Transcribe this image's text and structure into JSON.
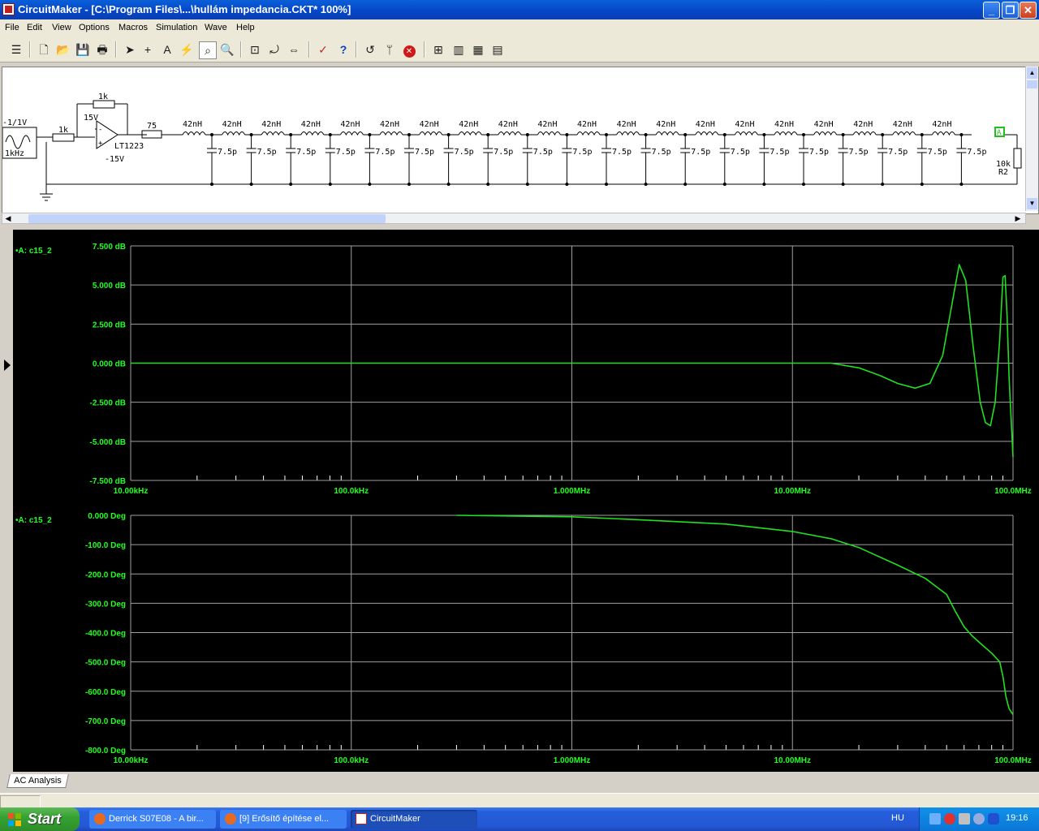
{
  "window": {
    "title": "CircuitMaker - [C:\\Program Files\\...\\hullám impedancia.CKT* 100%]",
    "buttons": {
      "minimize": "_",
      "maximize": "❐",
      "close": "✕"
    }
  },
  "menu": [
    "File",
    "Edit",
    "View",
    "Options",
    "Macros",
    "Simulation",
    "Wave",
    "Help"
  ],
  "toolbar": {
    "icons": [
      "tape-icon",
      "new-file-icon",
      "open-folder-icon",
      "save-icon",
      "print-icon",
      "arrow-tool-icon",
      "wire-tool-icon",
      "text-tool-icon",
      "probe-tool-icon",
      "zoom-hand-icon",
      "magnifier-icon",
      "zoom-fit-icon",
      "rotate-icon",
      "mirror-icon",
      "checklist-icon",
      "help-icon",
      "reset-icon",
      "stop-sim-icon",
      "step-icon",
      "run-icon",
      "waveform-icon",
      "analyses-icon"
    ]
  },
  "schematic": {
    "source_label": "-1/1V",
    "source_freq": "1kHz",
    "resistor_in": "1k",
    "resistor_fb": "1k",
    "supply_pos": "15V",
    "supply_neg": "-15V",
    "opamp": "LT1223",
    "resistor_series": "75",
    "inductor": "42nH",
    "capacitor": "7.5p",
    "load_value": "10k",
    "load_name": "R2",
    "probe_label": "A",
    "sections": 20
  },
  "plots": [
    {
      "name": "magnitude",
      "trace_label": "•A: c15_2",
      "y_ticks": [
        "7.500 dB",
        "5.000 dB",
        "2.500 dB",
        "0.000 dB",
        "-2.500 dB",
        "-5.000 dB",
        "-7.500 dB"
      ],
      "x_ticks": [
        "10.00kHz",
        "100.0kHz",
        "1.000MHz",
        "10.00MHz",
        "100.0MHz"
      ]
    },
    {
      "name": "phase",
      "trace_label": "•A: c15_2",
      "y_ticks": [
        "0.000 Deg",
        "-100.0 Deg",
        "-200.0 Deg",
        "-300.0 Deg",
        "-400.0 Deg",
        "-500.0 Deg",
        "-600.0 Deg",
        "-700.0 Deg",
        "-800.0 Deg"
      ],
      "x_ticks": [
        "10.00kHz",
        "100.0kHz",
        "1.000MHz",
        "10.00MHz",
        "100.0MHz"
      ]
    }
  ],
  "chart_data": [
    {
      "type": "line",
      "title": "",
      "xlabel": "",
      "ylabel": "",
      "x_scale": "log",
      "xlim": [
        10000,
        100000000
      ],
      "ylim": [
        -7.5,
        7.5
      ],
      "grid": true,
      "series": [
        {
          "name": "A: c15_2",
          "color": "#20e020",
          "x": [
            10000,
            1000000,
            5000000,
            10000000,
            15000000,
            20000000,
            25000000,
            30000000,
            36000000,
            42000000,
            48000000,
            54000000,
            57000000,
            61000000,
            66000000,
            71000000,
            75000000,
            79000000,
            83000000,
            87000000,
            90000000,
            92000000,
            94000000,
            96000000,
            98000000,
            100000000
          ],
          "y": [
            0,
            0,
            0,
            0,
            0,
            -0.3,
            -0.8,
            -1.3,
            -1.6,
            -1.3,
            0.5,
            4.5,
            6.3,
            5.3,
            1.0,
            -2.5,
            -3.8,
            -4.0,
            -2.5,
            1.5,
            5.5,
            5.6,
            3.0,
            -1.0,
            -3.5,
            -6.0
          ]
        }
      ]
    },
    {
      "type": "line",
      "title": "",
      "xlabel": "",
      "ylabel": "",
      "x_scale": "log",
      "xlim": [
        10000,
        100000000
      ],
      "ylim": [
        -800,
        0
      ],
      "grid": true,
      "series": [
        {
          "name": "A: c15_2",
          "color": "#20e020",
          "x": [
            300000,
            1000000,
            2000000,
            5000000,
            10000000,
            15000000,
            20000000,
            30000000,
            40000000,
            50000000,
            55000000,
            60000000,
            65000000,
            72000000,
            80000000,
            87000000,
            90000000,
            93000000,
            96000000,
            100000000
          ],
          "y": [
            0,
            -5,
            -15,
            -30,
            -55,
            -80,
            -110,
            -170,
            -215,
            -270,
            -330,
            -380,
            -410,
            -440,
            -470,
            -500,
            -550,
            -620,
            -660,
            -680
          ]
        }
      ]
    }
  ],
  "tab": "AC Analysis",
  "taskbar": {
    "start": "Start",
    "tasks": [
      "Derrick S07E08 - A bir...",
      "[9] Erősítő építése el...",
      "CircuitMaker"
    ],
    "lang": "HU",
    "clock": "19:16"
  }
}
